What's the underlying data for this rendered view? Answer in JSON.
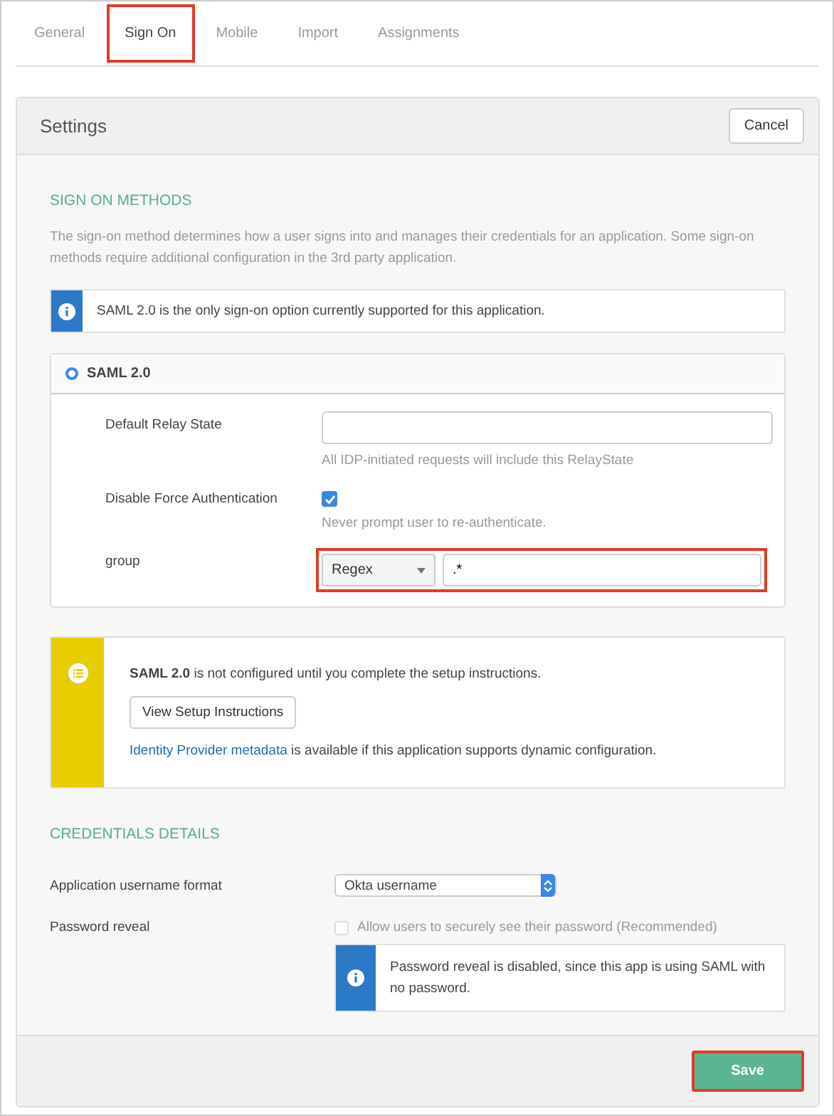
{
  "tabs": [
    {
      "label": "General",
      "selected": false,
      "highlighted": false
    },
    {
      "label": "Sign On",
      "selected": true,
      "highlighted": true
    },
    {
      "label": "Mobile",
      "selected": false,
      "highlighted": false
    },
    {
      "label": "Import",
      "selected": false,
      "highlighted": false
    },
    {
      "label": "Assignments",
      "selected": false,
      "highlighted": false
    }
  ],
  "settings": {
    "title": "Settings",
    "cancel_button": "Cancel",
    "save_button": {
      "label": "Save",
      "highlighted": true
    }
  },
  "sign_on_methods": {
    "heading": "SIGN ON METHODS",
    "description": "The sign-on method determines how a user signs into and manages their credentials for an application. Some sign-on methods require additional configuration in the 3rd party application.",
    "info_note": "SAML 2.0 is the only sign-on option currently supported for this application.",
    "method": {
      "label": "SAML 2.0",
      "selected": true
    },
    "fields": [
      {
        "kind": "text",
        "label": "Default Relay State",
        "help": "All IDP-initiated requests will include this RelayState"
      },
      {
        "kind": "checkbox",
        "label": "Disable Force Authentication",
        "checked": true,
        "help": "Never prompt user to re-authenticate."
      },
      {
        "kind": "group",
        "label": "group",
        "select": "Regex",
        "value": ".*",
        "highlighted": true
      }
    ]
  },
  "setup_notice": {
    "message": "**SAML 2.0** is not configured until you complete the setup instructions.",
    "button": "View Setup Instructions",
    "link": "Identity Provider metadata",
    "link_suffix": " is available if this application supports dynamic configuration."
  },
  "credentials": {
    "heading": "CREDENTIALS DETAILS",
    "username_format": {
      "label": "Application username format",
      "value": "Okta username"
    },
    "password_reveal": {
      "label": "Password reveal",
      "checkbox_label": "Allow users to securely see their password (Recommended)",
      "checked": false,
      "disabled": true,
      "note": "Password reveal is disabled, since this app is using SAML with no password."
    }
  }
}
